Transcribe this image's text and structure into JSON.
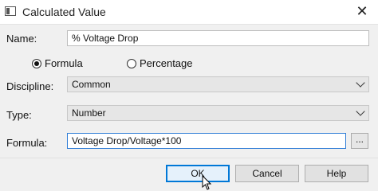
{
  "window": {
    "title": "Calculated Value",
    "close_glyph": "✕",
    "app_icon": "dialog-window-icon"
  },
  "form": {
    "name_label": "Name:",
    "name_value": "% Voltage Drop",
    "radio_formula_label": "Formula",
    "radio_percentage_label": "Percentage",
    "selected_mode": "Formula",
    "discipline_label": "Discipline:",
    "discipline_value": "Common",
    "type_label": "Type:",
    "type_value": "Number",
    "formula_label": "Formula:",
    "formula_value": "Voltage Drop/Voltage*100",
    "browse_label": "..."
  },
  "buttons": {
    "ok": "OK",
    "cancel": "Cancel",
    "help": "Help"
  },
  "colors": {
    "focus_blue": "#0078d7",
    "dialog_bg": "#f0f0f0"
  }
}
